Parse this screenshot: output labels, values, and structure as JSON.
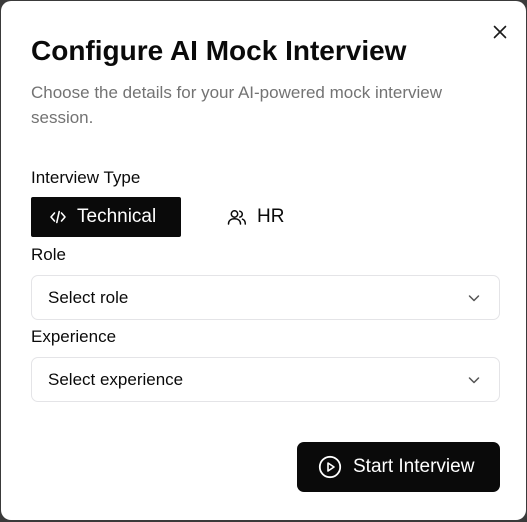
{
  "dialog": {
    "title": "Configure AI Mock Interview",
    "subtitle": "Choose the details for your AI-powered mock interview session."
  },
  "interview_type": {
    "label": "Interview Type",
    "options": [
      {
        "label": "Technical",
        "icon": "code-icon",
        "selected": true
      },
      {
        "label": "HR",
        "icon": "users-icon",
        "selected": false
      }
    ]
  },
  "role": {
    "label": "Role",
    "placeholder": "Select role"
  },
  "experience": {
    "label": "Experience",
    "placeholder": "Select experience"
  },
  "actions": {
    "start_label": "Start Interview",
    "start_icon": "play-circle-icon"
  },
  "colors": {
    "primary": "#0a0a0a",
    "muted_text": "#737373",
    "border": "#e4e4e7",
    "background": "#ffffff"
  }
}
